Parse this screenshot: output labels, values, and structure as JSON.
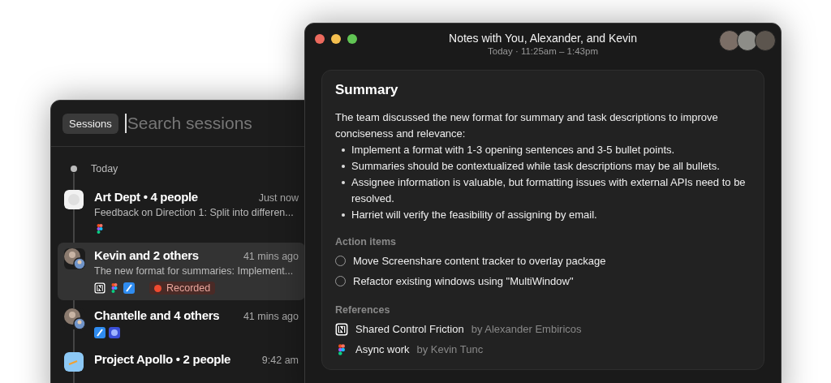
{
  "sessions_window": {
    "chip": "Sessions",
    "search": {
      "placeholder": "Search sessions"
    },
    "group": "Today",
    "sessions": [
      {
        "kind": "white-tile",
        "title": "Art Dept • 4 people",
        "time": "Just now",
        "preview": "Feedback on Direction 1: Split into differen...",
        "apps": [
          {
            "kind": "figma"
          }
        ],
        "selected": false
      },
      {
        "kind": "people",
        "title": "Kevin and 2 others",
        "time": "41 mins ago",
        "preview": "The new format for summaries: Implement...",
        "apps": [
          {
            "kind": "notion"
          },
          {
            "kind": "figma"
          },
          {
            "kind": "blue-slash"
          }
        ],
        "badge": "Recorded",
        "selected": true
      },
      {
        "kind": "people",
        "title": "Chantelle and 4 others",
        "time": "41 mins ago",
        "apps": [
          {
            "kind": "blue-slash"
          },
          {
            "kind": "blue-orb"
          }
        ],
        "selected": false
      },
      {
        "kind": "blue-tile",
        "title": "Project Apollo • 2 people",
        "time": "9:42 am",
        "selected": false
      }
    ]
  },
  "notes_window": {
    "title": "Notes with You, Alexander, and Kevin",
    "subtitle": "Today · 11:25am – 1:43pm",
    "summary": {
      "heading": "Summary",
      "intro": "The team discussed the new format for summary and task descriptions to improve conciseness and relevance:",
      "bullets": [
        "Implement a format with 1-3 opening sentences and 3-5 bullet points.",
        "Summaries should be contextualized while task descriptions may be all bullets.",
        "Assignee information is valuable, but formatting issues with external APIs need to be resolved.",
        "Harriet will verify the feasibility of assigning by email."
      ],
      "action_heading": "Action items",
      "action_items": [
        {
          "text": "Move Screenshare content tracker to overlay package",
          "checked": false
        },
        {
          "text": "Refactor existing windows using \"MultiWindow\"",
          "checked": false
        }
      ],
      "references_heading": "References",
      "references": [
        {
          "kind": "notion",
          "title": "Shared Control Friction",
          "author": "by Alexander Embiricos"
        },
        {
          "kind": "figma",
          "title": "Async work",
          "author": "by Kevin Tunc"
        }
      ]
    }
  }
}
